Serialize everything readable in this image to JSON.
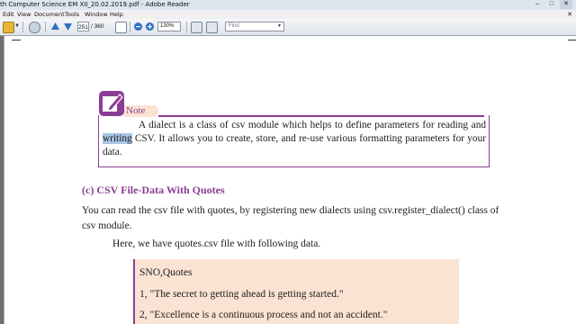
{
  "window": {
    "title": "th Computer Science EM XII_20.02.2019.pdf - Adobe Reader",
    "minimize": "–",
    "maximize": "□",
    "close": "✕"
  },
  "menu": {
    "items": [
      "Edit",
      "View",
      "Document",
      "Tools",
      "Window",
      "Help"
    ],
    "close_glyph": "✕"
  },
  "toolbar": {
    "page_current": "251",
    "page_total": "/ 360",
    "zoom": "130%",
    "find_placeholder": "Find",
    "dropdown_glyph": "▼"
  },
  "document": {
    "note": {
      "label": "Note",
      "text_before": "A dialect is a class of csv module which helps to define parameters for reading and ",
      "text_highlight": "writing",
      "text_after": " CSV. It allows you to create, store, and re-use various formatting parameters for your data."
    },
    "section_heading": "(c) CSV File-Data With Quotes",
    "paragraph1": "You can read the csv file with quotes, by registering new dialects using csv.register_dialect() class of csv module.",
    "paragraph2": "Here, we have quotes.csv file with following data.",
    "code_lines": [
      "SNO,Quotes",
      "1,  \"The secret to getting ahead is getting started.\"",
      "2,  \"Excellence is a continuous process and not an accident.\""
    ]
  },
  "colors": {
    "accent_purple": "#8a3d93",
    "note_tab_fill": "#fbe3d3",
    "selection_highlight": "#a8c6e4"
  }
}
